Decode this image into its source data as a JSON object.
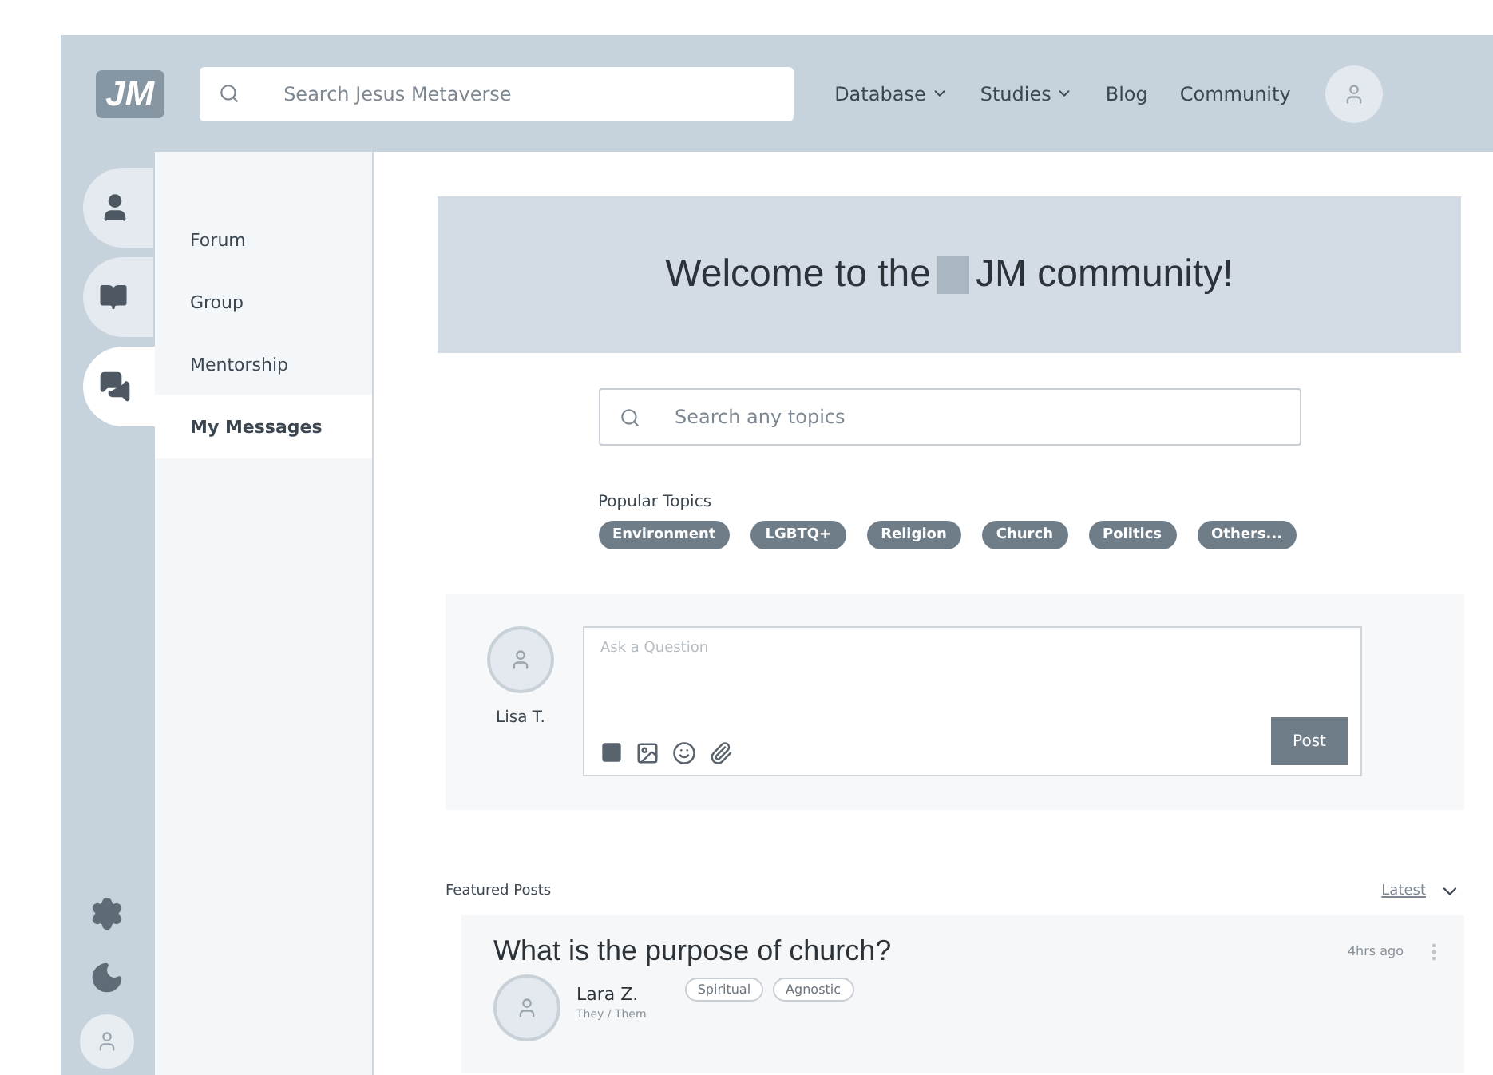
{
  "header": {
    "logo": "JM",
    "search": {
      "placeholder": "Search Jesus Metaverse"
    },
    "nav": [
      {
        "label": "Database",
        "has_menu": true
      },
      {
        "label": "Studies",
        "has_menu": true
      },
      {
        "label": "Blog",
        "has_menu": false
      },
      {
        "label": "Community",
        "has_menu": false
      }
    ]
  },
  "rail": {
    "items": [
      {
        "kind": "person",
        "selected": false
      },
      {
        "kind": "book",
        "selected": false
      },
      {
        "kind": "chat",
        "selected": true
      }
    ],
    "bottom": [
      {
        "kind": "gear"
      },
      {
        "kind": "moon"
      },
      {
        "kind": "avatar"
      }
    ]
  },
  "submenu": {
    "items": [
      {
        "label": "Forum",
        "selected": false
      },
      {
        "label": "Group",
        "selected": false
      },
      {
        "label": "Mentorship",
        "selected": false
      },
      {
        "label": "My Messages",
        "selected": true
      }
    ]
  },
  "banner": {
    "before": "Welcome to the",
    "after": "JM community!"
  },
  "topic_search": {
    "placeholder": "Search any topics"
  },
  "popular_topics": {
    "title": "Popular Topics",
    "tags": [
      "Environment",
      "LGBTQ+",
      "Religion",
      "Church",
      "Politics",
      "Others..."
    ]
  },
  "composer": {
    "user": "Lisa T.",
    "placeholder": "Ask a Question",
    "tools": [
      {
        "kind": "square"
      },
      {
        "kind": "image"
      },
      {
        "kind": "emoji"
      },
      {
        "kind": "attach"
      }
    ],
    "button": "Post"
  },
  "featured": {
    "title": "Featured Posts",
    "sort": "Latest",
    "posts": [
      {
        "title": "What is the purpose of church?",
        "time": "4hrs ago",
        "author": "Lara Z.",
        "pronouns": "They / Them",
        "tags": [
          "Spiritual",
          "Agnostic"
        ]
      }
    ]
  }
}
